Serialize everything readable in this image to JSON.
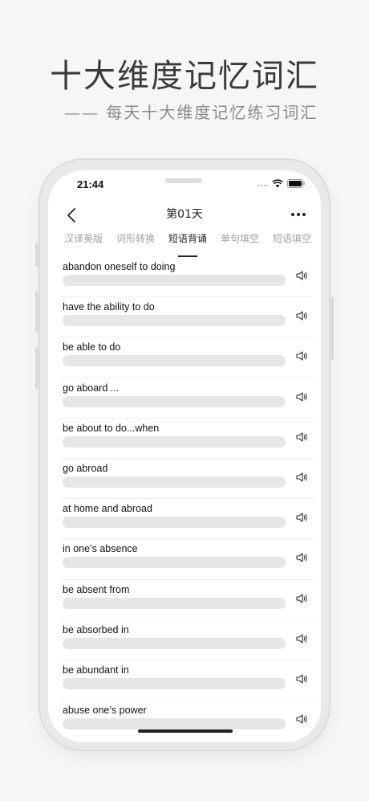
{
  "promo": {
    "title": "十大维度记忆词汇",
    "subtitle": "—— 每天十大维度记忆练习词汇"
  },
  "status_bar": {
    "time": "21:44"
  },
  "nav": {
    "title": "第01天"
  },
  "tabs": [
    {
      "label": "汉译英版",
      "active": false
    },
    {
      "label": "词形转换",
      "active": false
    },
    {
      "label": "短语背诵",
      "active": true
    },
    {
      "label": "单句填空",
      "active": false
    },
    {
      "label": "短语填空",
      "active": false
    }
  ],
  "phrases": [
    {
      "text": "abandon oneself to doing"
    },
    {
      "text": "have the ability to do"
    },
    {
      "text": "be able to do"
    },
    {
      "text": "go aboard ..."
    },
    {
      "text": "be about to do...when"
    },
    {
      "text": "go abroad"
    },
    {
      "text": "at home and abroad"
    },
    {
      "text": "in one’s absence"
    },
    {
      "text": "be absent from"
    },
    {
      "text": "be absorbed in"
    },
    {
      "text": "be abundant in"
    },
    {
      "text": "abuse one’s power"
    }
  ],
  "icons": {
    "back": "chevron-left-icon",
    "more": "more-dots-icon",
    "sound": "speaker-icon",
    "wifi": "wifi-icon",
    "battery": "battery-icon"
  },
  "colors": {
    "background": "#f6f6f6",
    "text": "#111111",
    "muted": "#a0a0a0",
    "bar": "#e6e6e6"
  }
}
